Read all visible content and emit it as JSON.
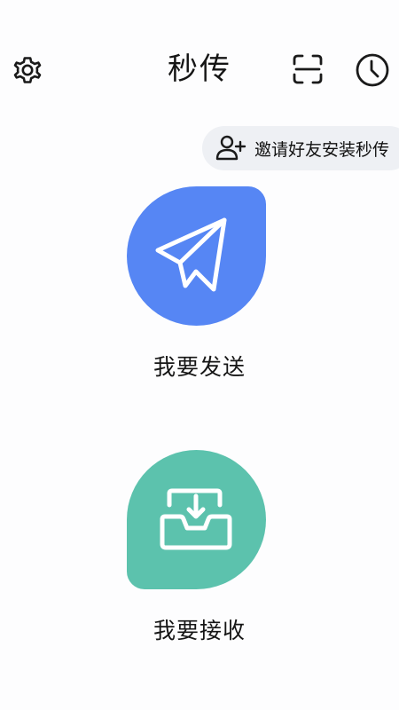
{
  "header": {
    "title": "秒传",
    "settings_icon": "gear-icon",
    "scan_icon": "scan-icon",
    "history_icon": "clock-icon"
  },
  "invite": {
    "label": "邀请好友安装秒传",
    "icon": "add-user-icon"
  },
  "actions": {
    "send": {
      "label": "我要发送",
      "icon": "paper-plane-icon",
      "color": "#5686f4"
    },
    "receive": {
      "label": "我要接收",
      "icon": "download-tray-icon",
      "color": "#5cc2ad"
    }
  }
}
